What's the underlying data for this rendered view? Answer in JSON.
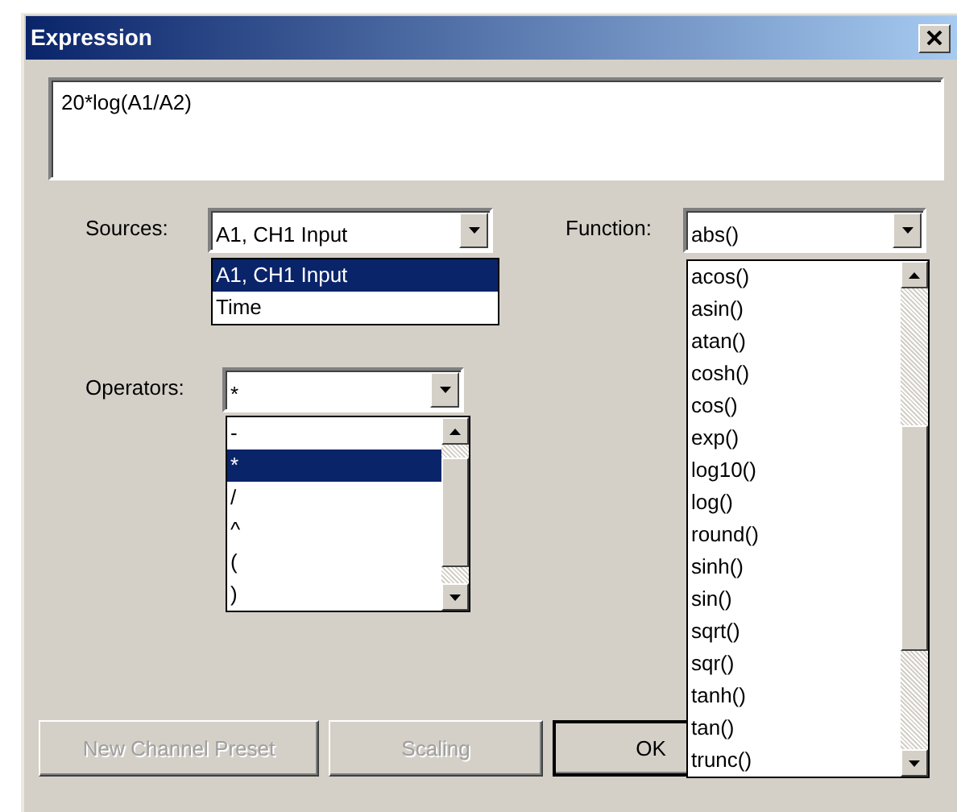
{
  "window": {
    "title": "Expression"
  },
  "expression": {
    "value": "20*log(A1/A2)"
  },
  "sources": {
    "label": "Sources:",
    "value": "A1, CH1 Input",
    "items": [
      {
        "label": "A1, CH1 Input",
        "selected": true
      },
      {
        "label": "Time",
        "selected": false
      }
    ]
  },
  "function": {
    "label": "Function:",
    "value": "abs()",
    "items": [
      {
        "label": "acos()",
        "selected": false
      },
      {
        "label": "asin()",
        "selected": false
      },
      {
        "label": "atan()",
        "selected": false
      },
      {
        "label": "cosh()",
        "selected": false
      },
      {
        "label": "cos()",
        "selected": false
      },
      {
        "label": "exp()",
        "selected": false
      },
      {
        "label": "log10()",
        "selected": false
      },
      {
        "label": "log()",
        "selected": false
      },
      {
        "label": "round()",
        "selected": false
      },
      {
        "label": "sinh()",
        "selected": false
      },
      {
        "label": "sin()",
        "selected": false
      },
      {
        "label": "sqrt()",
        "selected": false
      },
      {
        "label": "sqr()",
        "selected": false
      },
      {
        "label": "tanh()",
        "selected": false
      },
      {
        "label": "tan()",
        "selected": false
      },
      {
        "label": "trunc()",
        "selected": false
      }
    ]
  },
  "operators": {
    "label": "Operators:",
    "value": "*",
    "items": [
      {
        "label": "-",
        "selected": false
      },
      {
        "label": "*",
        "selected": true
      },
      {
        "label": "/",
        "selected": false
      },
      {
        "label": "^",
        "selected": false
      },
      {
        "label": "(",
        "selected": false
      },
      {
        "label": ")",
        "selected": false
      }
    ]
  },
  "buttons": [
    {
      "label": "New Channel Preset",
      "disabled": true
    },
    {
      "label": "Scaling",
      "disabled": true
    },
    {
      "label": "OK",
      "disabled": false
    }
  ]
}
